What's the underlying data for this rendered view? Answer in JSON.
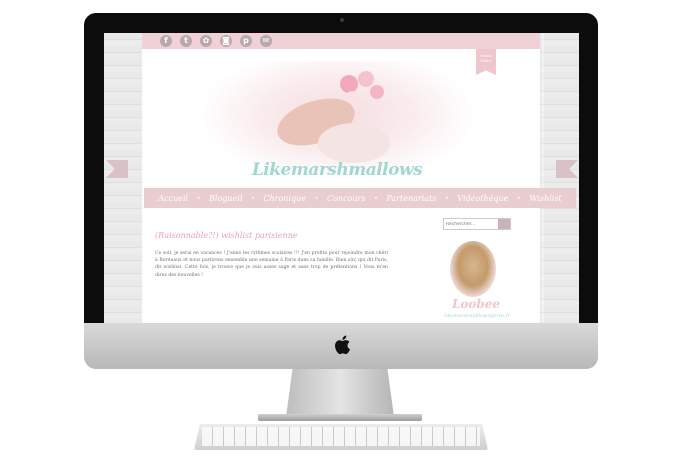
{
  "social": {
    "icons": [
      {
        "name": "facebook-icon",
        "glyph": "f"
      },
      {
        "name": "tumblr-icon",
        "glyph": "t"
      },
      {
        "name": "flower-icon",
        "glyph": "✿"
      },
      {
        "name": "instagram-icon",
        "glyph": "◙"
      },
      {
        "name": "pinterest-icon",
        "glyph": "p"
      },
      {
        "name": "mail-icon",
        "glyph": "✉"
      }
    ]
  },
  "ribbon": {
    "label": "Name letter"
  },
  "header": {
    "logo": "Likemarshmallows"
  },
  "nav": {
    "items": [
      "Accueil",
      "Blogueil",
      "Chronique",
      "Concours",
      "Partenariats",
      "Vidéothèque",
      "Wishlist"
    ],
    "separator": "•"
  },
  "post": {
    "title": "(Raisonnable?!) wishlist parisienne",
    "text_1": "Ce soir, je serai en vacances ! J'aime les rythmes scolaires !!! J'en profite pour rejoindre mon chéri à Bordeaux et",
    "text_2": "nous partirons ensemble une semaine à Paris dans sa famille. Bien sûr, qui dit Paris, dit wishlist. Cette fois, je",
    "text_3": "trouve que je suis assez sage et sans trop de prétentions ! Vous m'en direz des nouvelles !"
  },
  "sidebar": {
    "search_placeholder": "Rechercher...",
    "author_name": "Loobee",
    "author_email": "likemarshmallows@live.fr"
  },
  "colors": {
    "accent_pink": "#efc6cc",
    "accent_mint": "#9fd8d1",
    "nav_bg": "#e8cdd1"
  }
}
